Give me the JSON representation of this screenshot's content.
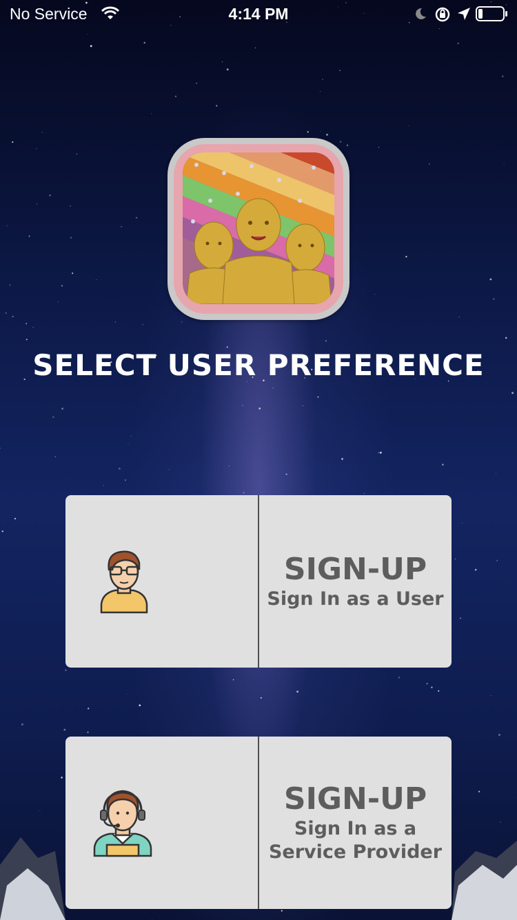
{
  "status_bar": {
    "carrier": "No Service",
    "time": "4:14 PM"
  },
  "page": {
    "title": "SELECT USER PREFERENCE"
  },
  "options": [
    {
      "title": "SIGN-UP",
      "subtitle_lines": [
        "Sign In as a User"
      ],
      "avatar_icon": "user-avatar-icon"
    },
    {
      "title": "SIGN-UP",
      "subtitle_lines": [
        "Sign In as a",
        "Service Provider"
      ],
      "avatar_icon": "support-agent-avatar-icon"
    }
  ],
  "colors": {
    "card_background": "#e0e0e0",
    "card_text": "#5d5d5d",
    "title_text": "#ffffff",
    "background": "#0e1c4e",
    "app_icon_frame": "#e7a5ad"
  }
}
